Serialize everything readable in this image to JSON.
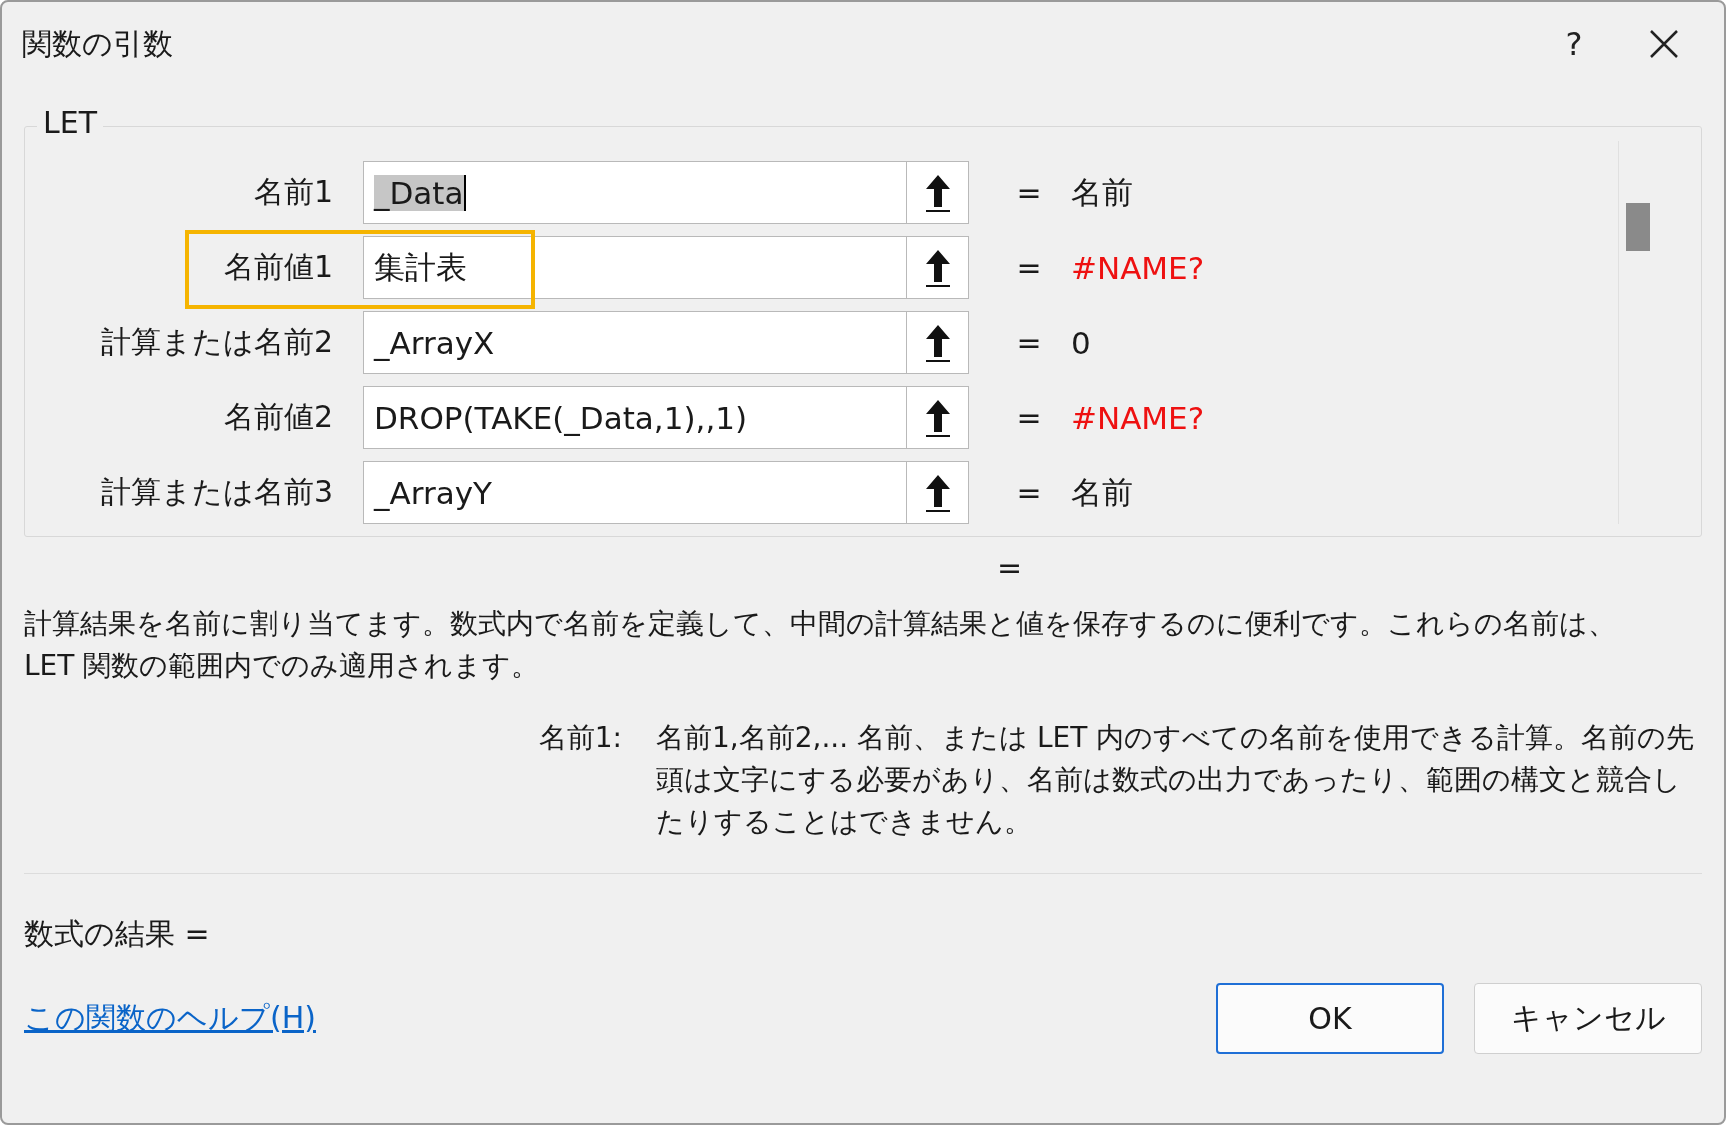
{
  "window": {
    "title": "関数の引数",
    "help_button": "?"
  },
  "group": {
    "title": "LET",
    "rows": [
      {
        "label": "名前1",
        "value": "_Data",
        "focused": true,
        "highlighted": false,
        "equals": "=",
        "result": "名前",
        "error": false
      },
      {
        "label": "名前値1",
        "value": "集計表",
        "focused": false,
        "highlighted": true,
        "equals": "=",
        "result": "#NAME?",
        "error": true
      },
      {
        "label": "計算または名前2",
        "value": "_ArrayX",
        "focused": false,
        "highlighted": false,
        "equals": "=",
        "result": "0",
        "error": false
      },
      {
        "label": "名前値2",
        "value": "DROP(TAKE(_Data,1),,1)",
        "focused": false,
        "highlighted": false,
        "equals": "=",
        "result": "#NAME?",
        "error": true
      },
      {
        "label": "計算または名前3",
        "value": "_ArrayY",
        "focused": false,
        "highlighted": false,
        "equals": "=",
        "result": "名前",
        "error": false
      }
    ]
  },
  "overall_result": "=",
  "description": "計算結果を名前に割り当てます。数式内で名前を定義して、中間の計算結果と値を保存するのに便利です。これらの名前は、LET 関数の範囲内でのみ適用されます。",
  "argument_help": {
    "label": "名前1:",
    "text": "名前1,名前2,... 名前、または LET 内のすべての名前を使用できる計算。名前の先頭は文字にする必要があり、名前は数式の出力であったり、範囲の構文と競合したりすることはできません。"
  },
  "formula_result": "数式の結果 =",
  "help_link": "この関数のヘルプ(H)",
  "buttons": [
    {
      "label": "OK",
      "default": true
    },
    {
      "label": "キャンセル",
      "default": false
    }
  ]
}
